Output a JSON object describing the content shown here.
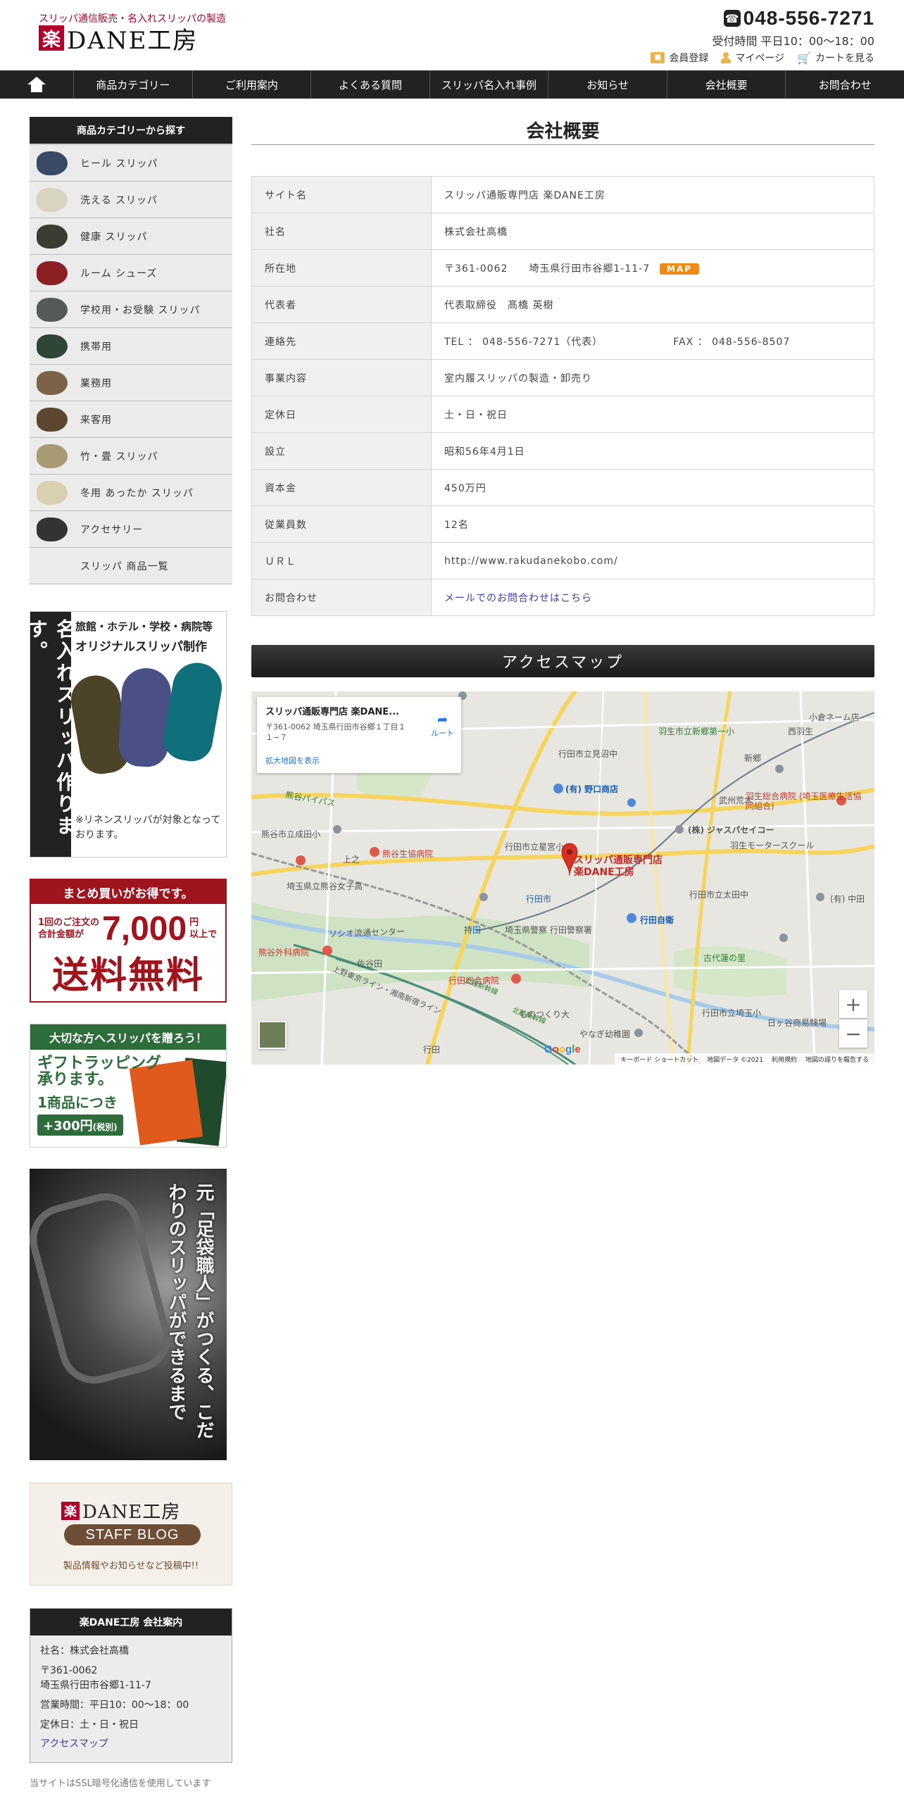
{
  "header": {
    "tagline": "スリッパ通信販売・名入れスリッパの製造",
    "logo_mark": "楽",
    "logo_text": "DANE工房",
    "phone": "048-556-7271",
    "hours": "受付時間 平日10：00～18：00",
    "links": [
      "会員登録",
      "マイページ",
      "カートを見る"
    ]
  },
  "nav": {
    "items": [
      "商品カテゴリー",
      "ご利用案内",
      "よくある質問",
      "スリッパ名入れ事例",
      "お知らせ",
      "会社概要",
      "お問合わせ"
    ]
  },
  "sidebar": {
    "category_heading": "商品カテゴリーから探す",
    "categories": [
      {
        "label": "ヒール スリッパ",
        "color": "#3a4a66"
      },
      {
        "label": "洗える スリッパ",
        "color": "#d8d4c2"
      },
      {
        "label": "健康 スリッパ",
        "color": "#3b3b32"
      },
      {
        "label": "ルーム シューズ",
        "color": "#8b1f24"
      },
      {
        "label": "学校用・お受験 スリッパ",
        "color": "#55595a"
      },
      {
        "label": "携帯用",
        "color": "#2f4536"
      },
      {
        "label": "業務用",
        "color": "#7b6248"
      },
      {
        "label": "来客用",
        "color": "#5c4630"
      },
      {
        "label": "竹・畳 スリッパ",
        "color": "#a89a72"
      },
      {
        "label": "冬用 あったか スリッパ",
        "color": "#d9d0b2"
      },
      {
        "label": "アクセサリー",
        "color": "#333333"
      },
      {
        "label": "スリッパ 商品一覧",
        "color": ""
      }
    ],
    "banner_custom": {
      "vertical": "名入れスリッパ作ります。",
      "title1": "旅館・ホテル・学校・病院等",
      "title2": "オリジナルスリッパ制作",
      "note": "※リネンスリッパが対象となっております。"
    },
    "banner_bulk": {
      "top": "まとめ買いがお得です。",
      "small": "1回のご注文の\n合計金額が",
      "amount": "7,000",
      "unit": "円\n以上で",
      "free": "送料無料"
    },
    "banner_gift": {
      "top": "大切な方へスリッパを贈ろう！",
      "line1": "ギフトラッピング",
      "line2": "承ります。",
      "line3": "1商品につき",
      "price": "+300円",
      "tax": "(税別)"
    },
    "banner_craftsman": {
      "text": "元「足袋職人」がつくる、こだわりのスリッパができるまで"
    },
    "banner_blog": {
      "mark": "楽",
      "name": "DANE工房",
      "pill": "STAFF BLOG",
      "note": "製品情報やお知らせなど投稿中!!"
    },
    "company_box": {
      "heading": "楽DANE工房 会社案内",
      "company": "社名：株式会社高橋",
      "postal": "〒361-0062",
      "address": "埼玉県行田市谷郷1-11-7",
      "hours": "営業時間：平日10：00～18：00",
      "holiday": "定休日：土・日・祝日",
      "access": "アクセスマップ"
    },
    "ssl_note": "当サイトはSSL暗号化通信を使用しています"
  },
  "main": {
    "title": "会社概要",
    "rows": [
      {
        "k": "サイト名",
        "v": "スリッパ通販専門店 楽DANE工房"
      },
      {
        "k": "社名",
        "v": "株式会社高橋"
      },
      {
        "k": "所在地",
        "v": "〒361-0062　　埼玉県行田市谷郷1-11-7"
      },
      {
        "k": "代表者",
        "v": "代表取締役　髙橋 英樹"
      },
      {
        "k": "連絡先",
        "v": "TEL ： 048-556-7271（代表）"
      },
      {
        "k": "事業内容",
        "v": "室内履スリッパの製造・卸売り"
      },
      {
        "k": "定休日",
        "v": "土・日・祝日"
      },
      {
        "k": "設立",
        "v": "昭和56年4月1日"
      },
      {
        "k": "資本金",
        "v": "450万円"
      },
      {
        "k": "従業員数",
        "v": "12名"
      },
      {
        "k": "ＵＲＬ",
        "v": "http://www.rakudanekobo.com/"
      },
      {
        "k": "お問合わせ",
        "v": "メールでのお問合わせはこちら"
      }
    ],
    "fax": "FAX ： 048-556-8507",
    "map_badge": "MAP",
    "access_heading": "アクセスマップ",
    "map": {
      "card_title": "スリッパ通販専門店 楽DANE...",
      "card_address": "〒361-0062 埼玉県行田市谷郷１丁目１１−７",
      "card_route": "ルート",
      "card_link": "拡大地図を表示",
      "pin_label": "スリッパ通販専門店 楽DANE工房",
      "footer": [
        "キーボード ショートカット",
        "地図データ ©2021",
        "利用規約",
        "地図の誤りを報告する"
      ],
      "places": [
        "羽生市立新郷第一小",
        "西羽生",
        "行田市立見沼中",
        "(有) 野口商店",
        "武州荒木",
        "羽生総合病院 (埼玉医療生活協同組合)",
        "熊谷バイパス",
        "熊谷市立成田小",
        "行田市立星宮小",
        "(株) ジャスパセイコー",
        "羽生モータースクール",
        "熊谷生協病院",
        "上之",
        "埼玉県立熊谷女子高",
        "行田市",
        "行田市立太田中",
        "(有) 中田",
        "ソシオ流通センター",
        "持田",
        "埼玉県警察 行田警察署",
        "行田自衛",
        "熊谷外科病院",
        "佐谷田",
        "古代蓮の里",
        "行田総合病院",
        "ものつくり大",
        "行田市立埼玉小",
        "やなぎ幼稚園",
        "日ヶ谷商易験場",
        "小倉ネーム店",
        "新郷",
        "上越新幹線",
        "北陸新幹線",
        "上野東京ライン・湘南新宿ライン",
        "行田"
      ]
    }
  }
}
